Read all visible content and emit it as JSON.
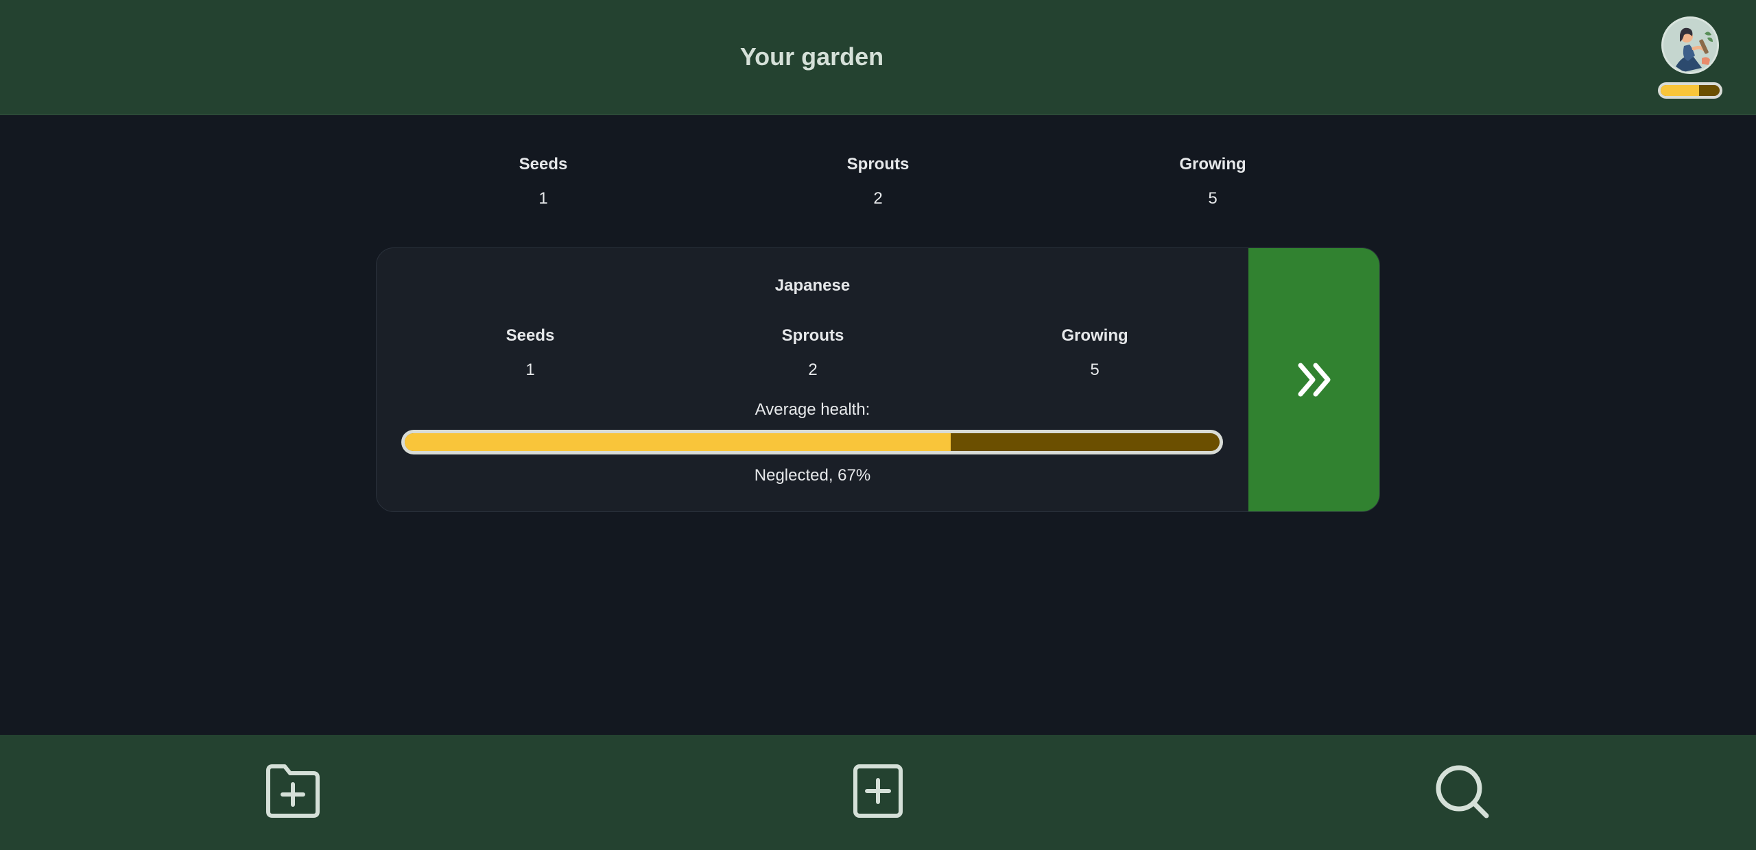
{
  "header": {
    "title": "Your garden",
    "avatar_icon": "gardener-avatar-icon",
    "xp_progress": 0.65
  },
  "summary": {
    "items": [
      {
        "label": "Seeds",
        "value": "1"
      },
      {
        "label": "Sprouts",
        "value": "2"
      },
      {
        "label": "Growing",
        "value": "5"
      }
    ]
  },
  "garden_card": {
    "name": "Japanese",
    "stats": [
      {
        "label": "Seeds",
        "value": "1"
      },
      {
        "label": "Sprouts",
        "value": "2"
      },
      {
        "label": "Growing",
        "value": "5"
      }
    ],
    "health_label": "Average health:",
    "health_percent": 67,
    "health_status": "Neglected, 67%",
    "open_icon": "double-chevron-right-icon"
  },
  "bottom_nav": {
    "items": [
      {
        "icon": "folder-plus-icon"
      },
      {
        "icon": "square-plus-icon"
      },
      {
        "icon": "search-icon"
      }
    ]
  },
  "colors": {
    "header_bg": "#244230",
    "page_bg": "#131820",
    "card_bg": "#1a1f27",
    "accent_green": "#318230",
    "health_fill": "#f9c53a",
    "health_track": "#6b4f00",
    "icon_color": "#d5e0d8"
  }
}
